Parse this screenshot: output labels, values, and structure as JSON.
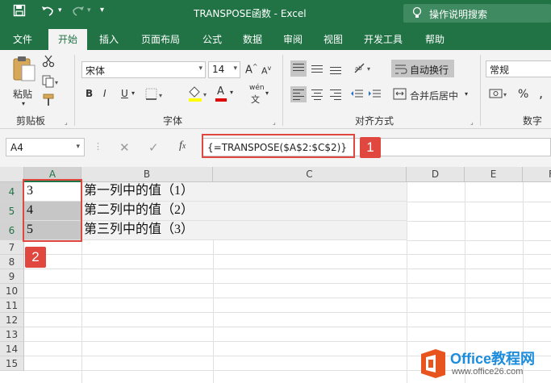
{
  "titlebar": {
    "title": "TRANSPOSE函数 - Excel",
    "tell_me": "操作说明搜索"
  },
  "tabs": [
    "文件",
    "开始",
    "插入",
    "页面布局",
    "公式",
    "数据",
    "审阅",
    "视图",
    "开发工具",
    "帮助"
  ],
  "ribbon": {
    "clipboard": {
      "paste_label": "粘贴",
      "group_label": "剪贴板"
    },
    "font": {
      "font_name": "宋体",
      "font_size": "14",
      "bold": "B",
      "italic": "I",
      "underline": "U",
      "grow": "A",
      "shrink": "A",
      "color_a": "A",
      "phonetic": "wén",
      "group_label": "字体"
    },
    "alignment": {
      "wrap_label": "自动换行",
      "merge_label": "合并后居中",
      "group_label": "对齐方式"
    },
    "number": {
      "format": "常规",
      "percent": "%",
      "comma": ",",
      "group_label": "数字"
    }
  },
  "formula_bar": {
    "name_box": "A4",
    "formula": "{=TRANSPOSE($A$2:$C$2)}"
  },
  "grid": {
    "columns": [
      "A",
      "B",
      "C",
      "D",
      "E",
      "F"
    ],
    "rows": [
      "4",
      "5",
      "6",
      "7",
      "8",
      "9",
      "10",
      "11",
      "12",
      "13",
      "14",
      "15"
    ],
    "cells": [
      {
        "a": "3",
        "b": "第一列中的值（1）"
      },
      {
        "a": "4",
        "b": "第二列中的值（2）"
      },
      {
        "a": "5",
        "b": "第三列中的值（3）"
      }
    ]
  },
  "annotations": {
    "badge1": "1",
    "badge2": "2"
  },
  "watermark": {
    "brand": "Office教程网",
    "url": "www.office26.com"
  }
}
